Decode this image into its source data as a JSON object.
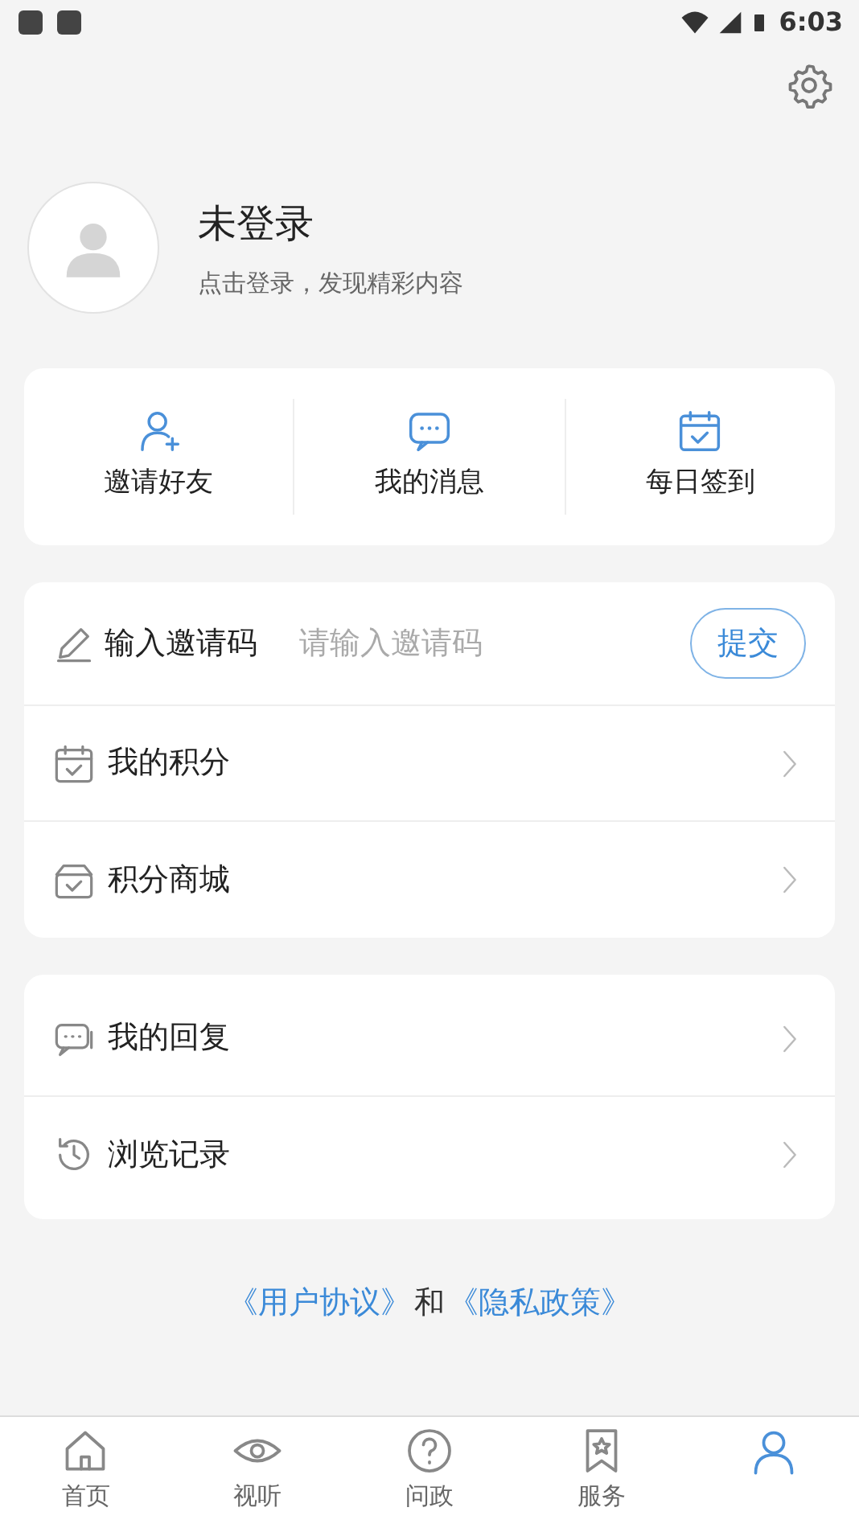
{
  "status_bar": {
    "time": "6:03"
  },
  "profile": {
    "name": "未登录",
    "subtitle": "点击登录，发现精彩内容"
  },
  "quick_actions": [
    {
      "label": "邀请好友"
    },
    {
      "label": "我的消息"
    },
    {
      "label": "每日签到"
    }
  ],
  "invite": {
    "label": "输入邀请码",
    "placeholder": "请输入邀请码",
    "button": "提交"
  },
  "menu_group_1": [
    {
      "label": "我的积分"
    },
    {
      "label": "积分商城"
    }
  ],
  "menu_group_2": [
    {
      "label": "我的回复"
    },
    {
      "label": "浏览记录"
    }
  ],
  "footer": {
    "agreement": "《用户协议》",
    "and": "和",
    "privacy": "《隐私政策》"
  },
  "tabs": [
    {
      "label": "首页",
      "selected": false
    },
    {
      "label": "视听",
      "selected": false
    },
    {
      "label": "问政",
      "selected": false
    },
    {
      "label": "服务",
      "selected": false
    },
    {
      "selected": true
    }
  ]
}
